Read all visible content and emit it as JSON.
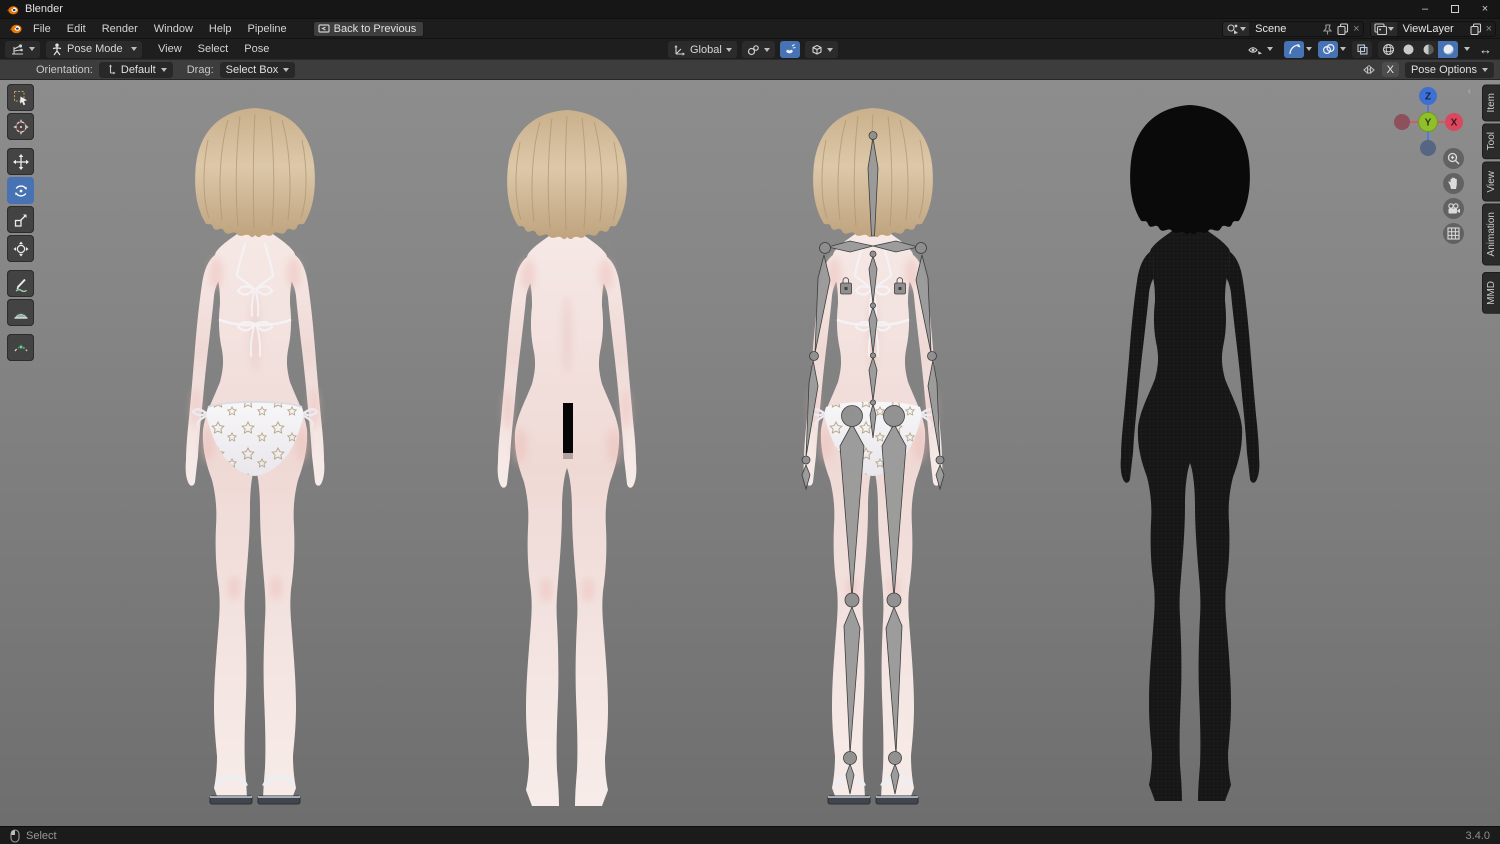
{
  "window": {
    "title": "Blender"
  },
  "icons": {
    "minimize": "–",
    "close": "×",
    "close_small": "×",
    "expand": "↔",
    "collapse_left": "‹"
  },
  "menubar": {
    "items": [
      "File",
      "Edit",
      "Render",
      "Window",
      "Help",
      "Pipeline"
    ],
    "back_button": "Back to Previous",
    "scene_selector": {
      "value": "Scene"
    },
    "view_layer_selector": {
      "value": "ViewLayer"
    }
  },
  "viewport_header": {
    "mode": "Pose Mode",
    "menus": [
      "View",
      "Select",
      "Pose"
    ],
    "transform_orientation": "Global"
  },
  "tool_settings": {
    "orientation_label": "Orientation:",
    "orientation_value": "Default",
    "drag_label": "Drag:",
    "drag_value": "Select Box",
    "mirror_x_label": "X",
    "pose_options_label": "Pose Options"
  },
  "left_toolbar": {
    "tools": [
      "tweak-select",
      "cursor",
      "move",
      "rotate",
      "scale",
      "transform",
      "annotate",
      "measure",
      "pose-breakdowner"
    ],
    "active_tool": "rotate"
  },
  "nav_gizmo": {
    "axis_z": "Z",
    "axis_y": "Y",
    "axis_x": "X"
  },
  "sidebar_tabs": [
    "Item",
    "Tool",
    "View",
    "Animation",
    "MMD"
  ],
  "viewport_models": [
    "textured-bikini-model",
    "textured-censored-model",
    "armature-overlay-model",
    "wireframe-dark-model"
  ],
  "statusbar": {
    "left": "Select",
    "version": "3.4.0"
  },
  "colors": {
    "accent": "#4772b4",
    "viewport_top": "#8d8d8d",
    "viewport_bottom": "#6e6e6e",
    "skin": "#f3dfdb",
    "hair": "#d2b896",
    "bone": "#9a9a9a",
    "axis_x": "#d8495f",
    "axis_y": "#8fbf2a",
    "axis_z": "#3e6fd2"
  }
}
